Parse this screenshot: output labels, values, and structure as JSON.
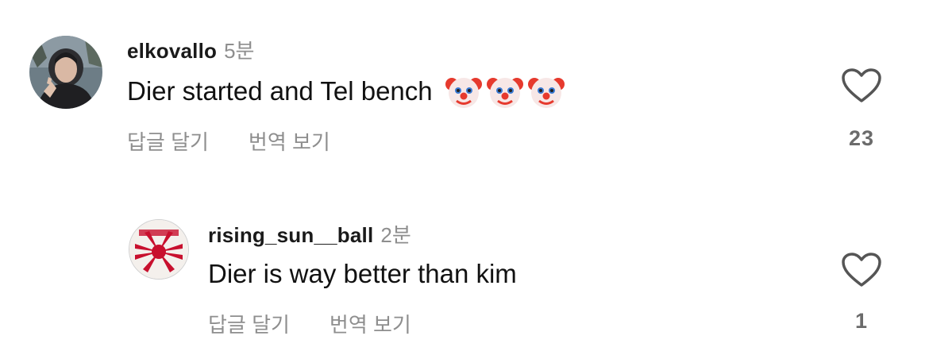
{
  "comments": [
    {
      "username": "elkovallo",
      "time": "5분",
      "text": "Dier started and Tel bench",
      "emojis": [
        "clown-face-emoji",
        "clown-face-emoji",
        "clown-face-emoji"
      ],
      "reply_label": "답글 달기",
      "translate_label": "번역 보기",
      "likes": "23",
      "avatar_icon": "user-avatar-photo"
    },
    {
      "username": "rising_sun__ball",
      "time": "2분",
      "text": "Dier is way better than kim",
      "reply_label": "답글 달기",
      "translate_label": "번역 보기",
      "likes": "1",
      "avatar_icon": "rising-sun-flag-avatar"
    }
  ],
  "colors": {
    "text": "#111111",
    "secondary": "#8e8e8e",
    "heart_stroke": "#555555"
  }
}
